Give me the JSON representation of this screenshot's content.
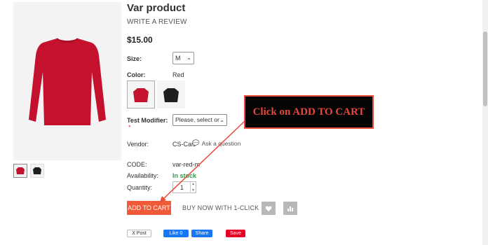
{
  "product": {
    "title": "Var product",
    "write_review": "WRITE A REVIEW",
    "price": "$15.00"
  },
  "options": {
    "size_label": "Size:",
    "size_value": "M",
    "color_label": "Color:",
    "color_value": "Red",
    "modifier_label": "Test Modifier:",
    "modifier_value": "Please, select one",
    "required_mark": "*"
  },
  "details": {
    "vendor_label": "Vendor:",
    "vendor_value": "CS-Cart",
    "ask_question": "Ask a question",
    "code_label": "CODE:",
    "code_value": "var-red-m",
    "availability_label": "Availability:",
    "availability_value": "In stock",
    "quantity_label": "Quantity:",
    "quantity_value": "1"
  },
  "actions": {
    "add_to_cart": "ADD TO CART",
    "buy_now": "BUY NOW WITH 1-CLICK"
  },
  "social": {
    "twitter": "X Post",
    "fb_like": "Like 0",
    "fb_share": "Share",
    "pinterest": "Save"
  },
  "annotation": {
    "callout_text": "Click on ADD TO CART"
  },
  "colors": {
    "accent": "#f05a38",
    "stock": "#2e9e4a",
    "callout_border": "#e8483a",
    "sweater_red": "#c4112e",
    "sweater_black": "#1e1e1e"
  }
}
